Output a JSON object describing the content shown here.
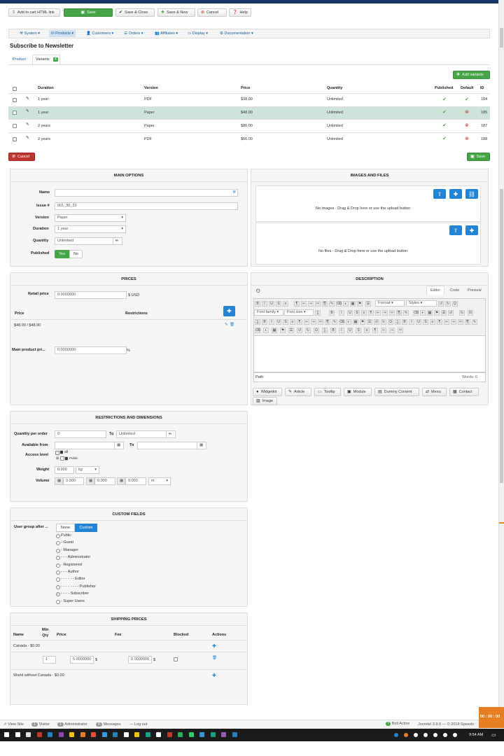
{
  "toolbar": {
    "add_to_cart": "Add to cart HTML link",
    "save": "Save",
    "save_close": "Save & Close",
    "save_new": "Save & New",
    "cancel": "Cancel",
    "help": "Help"
  },
  "menu": [
    "System",
    "Products",
    "Customers",
    "Orders",
    "Affiliates",
    "Display",
    "Documentation"
  ],
  "page_title": "Subscribe to Newsletter",
  "tabs": {
    "product": "Product",
    "variants": "Variants",
    "variants_count": "4"
  },
  "add_variants": "Add variants",
  "variants_table": {
    "headers": {
      "duration": "Duration",
      "version": "Version",
      "price": "Price",
      "quantity": "Quantity",
      "published": "Published",
      "default": "Default",
      "id": "ID"
    },
    "rows": [
      {
        "duration": "1 year",
        "version": "PDF",
        "price": "$38.00",
        "quantity": "Unlimited",
        "published": true,
        "default": true,
        "id": "184"
      },
      {
        "duration": "1 year",
        "version": "Paper",
        "price": "$48.00",
        "quantity": "Unlimited",
        "published": true,
        "default": false,
        "id": "185"
      },
      {
        "duration": "2 years",
        "version": "Paper",
        "price": "$86.00",
        "quantity": "Unlimited",
        "published": true,
        "default": false,
        "id": "187"
      },
      {
        "duration": "2 years",
        "version": "PDF",
        "price": "$66.00",
        "quantity": "Unlimited",
        "published": true,
        "default": false,
        "id": "188"
      }
    ]
  },
  "cancel_btn": "Cancel",
  "save_btn": "Save",
  "main_options": {
    "title": "MAIN OPTIONS",
    "name_label": "Name",
    "name_value": "",
    "issue_label": "Issue #",
    "issue_value": "001_30_33",
    "version_label": "Version",
    "version_value": "Paper",
    "duration_label": "Duration",
    "duration_value": "1 year",
    "quantity_label": "Quantity",
    "quantity_value": "Unlimited",
    "published_label": "Published",
    "yes": "Yes",
    "no": "No"
  },
  "images_files": {
    "title": "IMAGES AND FILES",
    "no_images": "No images - Drag & Drop here or use the upload button",
    "no_files": "No files - Drag & Drop here or use the upload button"
  },
  "prices": {
    "title": "PRICES",
    "retail_label": "Retail price",
    "retail_value": "0.0000000",
    "currency": "$ USD",
    "col_price": "Price",
    "col_restrictions": "Restrictions",
    "row_price": "$48.00 / $48.00",
    "main_label": "Main product pri...",
    "main_value": "0.0000000",
    "percent": "%"
  },
  "description": {
    "title": "DESCRIPTION",
    "tab_editor": "Editor",
    "tab_code": "Code",
    "tab_preview": "Preview",
    "format": "Format",
    "styles": "Styles",
    "font_family": "Font family",
    "font_size": "Font size",
    "path": "Path:",
    "words": "Words: 0",
    "plugins": [
      "Widgetkit",
      "Article",
      "Tooltip",
      "Module",
      "Dummy Content",
      "Menu",
      "Contact",
      "Image"
    ]
  },
  "restrictions": {
    "title": "RESTRICTIONS AND DIMENSIONS",
    "qty_label": "Quantity per order",
    "qty_from": "0",
    "to": "To",
    "qty_to": "Unlimited",
    "avail_label": "Available from",
    "access_label": "Access level",
    "access_all": "all",
    "access_public": "Public",
    "weight_label": "Weight",
    "weight_value": "0.000",
    "weight_unit": "kg",
    "volume_label": "Volume",
    "vol1": "0.000",
    "vol2": "0.000",
    "vol3": "0.000",
    "vol_unit": "m"
  },
  "custom_fields": {
    "title": "CUSTOM FIELDS",
    "label": "User group after ...",
    "none": "None",
    "custom": "Custom",
    "groups": [
      "Public",
      "- Guest",
      "- Manager",
      "- - - Administrator",
      "- Registered",
      "- - - Author",
      "- - - - - - Editor",
      "- - - - - - - - Publisher",
      "- - - - Subscriber",
      "- Super Users"
    ]
  },
  "shipping": {
    "title": "SHIPPING PRICES",
    "col_name": "Name",
    "col_min": "Min\nQty",
    "col_price": "Price",
    "col_fee": "Fee",
    "col_blocked": "Blocked",
    "col_actions": "Actions",
    "canada": "Canada - $0.00",
    "min_qty": "1",
    "price": "5.0000000",
    "fee": "0.0000000",
    "dollar": "$",
    "world": "World without Canada - $0.00"
  },
  "statusbar": {
    "view_site": "View Site",
    "visitor_count": "1",
    "visitor": "Visitor",
    "admin_count": "1",
    "administrator": "Administrator",
    "messages_count": "0",
    "messages": "Messages",
    "logout": "Log out",
    "bolt": "Bolt Active",
    "joomla": "Joomla! 3.9.0 — © 2018 Speedo"
  },
  "taskbar": {
    "time": "9:54 AM",
    "clock_widget": "00 : 00 : 00"
  },
  "colors": {
    "accent_green": "#46a546",
    "accent_blue": "#2384d3",
    "danger": "#bd362f",
    "highlight_row": "#cfe3dd"
  }
}
